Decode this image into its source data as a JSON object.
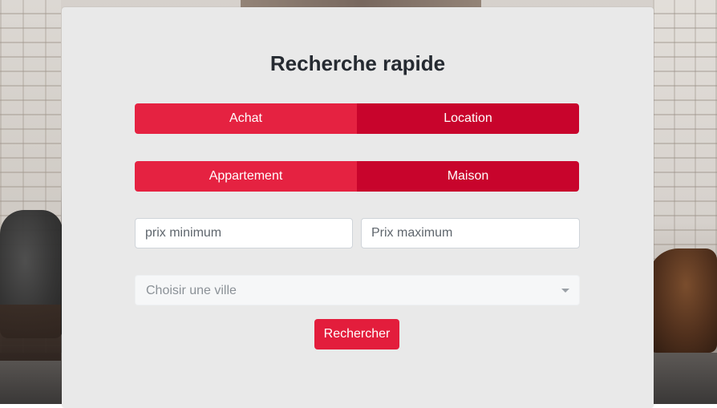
{
  "form": {
    "title": "Recherche rapide",
    "transaction_toggle": {
      "options": [
        "Achat",
        "Location"
      ]
    },
    "property_toggle": {
      "options": [
        "Appartement",
        "Maison"
      ]
    },
    "price_min": {
      "value": "",
      "placeholder": "prix minimum"
    },
    "price_max": {
      "value": "",
      "placeholder": "Prix maximum"
    },
    "city_select": {
      "placeholder": "Choisir une ville"
    },
    "search_button": "Rechercher"
  },
  "colors": {
    "panel_bg": "#e9e9e9",
    "toggle_light": "#e52241",
    "toggle_dark": "#c8042c",
    "button": "#e31d3c",
    "title_text": "#252a31"
  }
}
